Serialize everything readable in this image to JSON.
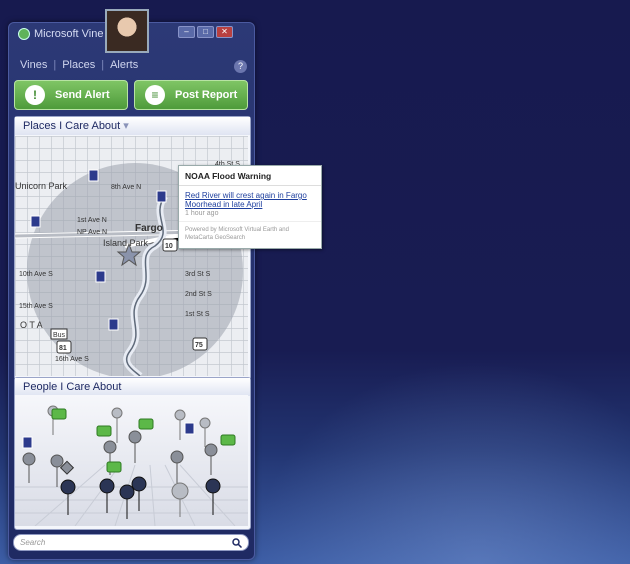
{
  "app": {
    "brand": "Microsoft Vine"
  },
  "window_controls": {
    "minimize": "–",
    "maximize": "□",
    "close": "✕"
  },
  "nav": {
    "items": [
      "Vines",
      "Places",
      "Alerts"
    ],
    "help": "?"
  },
  "actions": {
    "send_alert": "Send Alert",
    "post_report": "Post Report"
  },
  "places": {
    "title": "Places I Care About",
    "arrow": "▾"
  },
  "map_labels": {
    "labels": [
      "Fargo",
      "Island Park",
      "Unicorn Park",
      "8th Ave N",
      "1st Ave N",
      "NP Ave N",
      "10th Ave S",
      "15th Ave S",
      "16th Ave S",
      "Bus",
      "81",
      "10",
      "75",
      "O T A",
      "4th St S",
      "3rd St S",
      "2nd St S",
      "1st St S"
    ]
  },
  "alert": {
    "title": "NOAA Flood Warning",
    "link": "Red River will crest again in Fargo Moorhead in late April",
    "time": "1 hour ago",
    "powered_by": "Powered by Microsoft Virtual Earth and MetaCarta GeoSearch"
  },
  "people": {
    "title": "People I Care About"
  },
  "search": {
    "placeholder": "Search",
    "icon": "search-icon"
  },
  "colors": {
    "accent_green": "#5aa845",
    "chrome_blue": "#1f2a63"
  }
}
